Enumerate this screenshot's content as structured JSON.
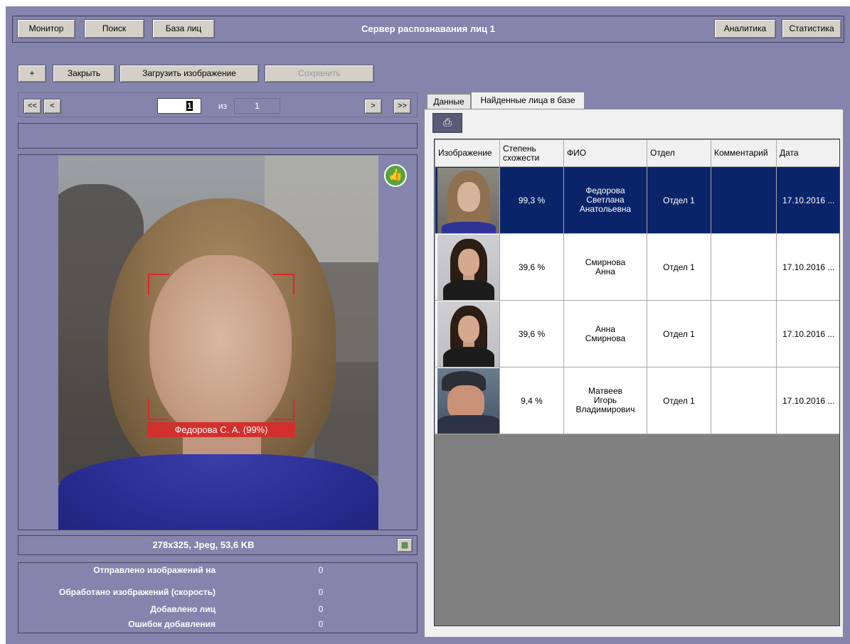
{
  "header": {
    "title": "Сервер распознавания лиц 1",
    "left_buttons": [
      "Монитор",
      "Поиск",
      "База лиц"
    ],
    "right_buttons": [
      "Аналитика",
      "Статистика"
    ]
  },
  "toolbar": {
    "add": "+",
    "close": "Закрыть",
    "upload": "Загрузить изображение",
    "save": "Сохранить"
  },
  "pager": {
    "first": "<<",
    "prev": "<",
    "next": ">",
    "last": ">>",
    "current": "1",
    "of": "из",
    "total": "1"
  },
  "image": {
    "face_label": "Федорова С. А. (99%)",
    "info": "278x325, Jpeg, 53,6 KB"
  },
  "stats": [
    {
      "label": "Отправлено изображений на",
      "value": "0"
    },
    {
      "label": "Обработано изображений (скорость)",
      "value": "0"
    },
    {
      "label": "Добавлено лиц",
      "value": "0"
    },
    {
      "label": "Ошибок добавления",
      "value": "0"
    }
  ],
  "tabs": [
    "Данные",
    "Найденные лица в базе"
  ],
  "table": {
    "columns": [
      "Изображение",
      "Степень\nсхожести",
      "ФИО",
      "Отдел",
      "Комментарий",
      "Дата"
    ],
    "rows": [
      {
        "similarity": "99,3 %",
        "name": "Федорова\nСветлана\nАнатольевна",
        "dept": "Отдел 1",
        "comment": "",
        "date": "17.10.2016 ...",
        "thumb": "fed"
      },
      {
        "similarity": "39,6 %",
        "name": "Смирнова\nАнна",
        "dept": "Отдел 1",
        "comment": "",
        "date": "17.10.2016 ...",
        "thumb": "female"
      },
      {
        "similarity": "39,6 %",
        "name": "Анна\nСмирнова",
        "dept": "Отдел 1",
        "comment": "",
        "date": "17.10.2016 ...",
        "thumb": "female"
      },
      {
        "similarity": "9,4 %",
        "name": "Матвеев\nИгорь\nВладимирович",
        "dept": "Отдел 1",
        "comment": "",
        "date": "17.10.2016 ...",
        "thumb": "male"
      }
    ]
  },
  "icons": {
    "approve": "thumbs-up-icon",
    "print": "printer-icon",
    "save_image": "save-image-icon"
  },
  "colors": {
    "background": "#8584ac",
    "selection": "#0a246a",
    "face_frame": "#e0262a",
    "approve": "#55a63a"
  }
}
